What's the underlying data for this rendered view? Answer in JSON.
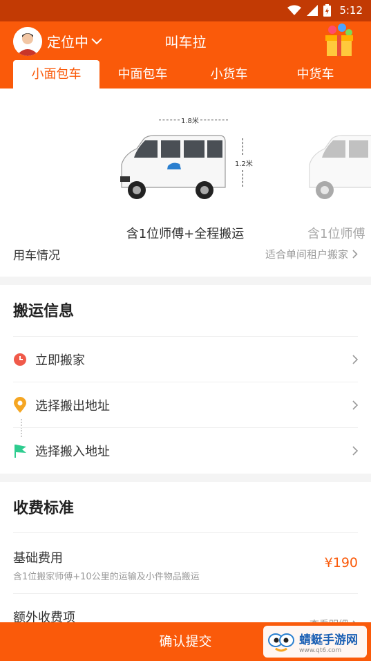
{
  "status_bar": {
    "time": "5:12"
  },
  "header": {
    "location_label": "定位中",
    "title": "叫车拉"
  },
  "tabs": [
    {
      "label": "小面包车",
      "active": true
    },
    {
      "label": "中面包车",
      "active": false
    },
    {
      "label": "小货车",
      "active": false
    },
    {
      "label": "中货车",
      "active": false
    }
  ],
  "vehicles": [
    {
      "width_dim": "1.8米",
      "height_dim": "1.2米",
      "caption": "含1位师傅+全程搬运"
    },
    {
      "caption": "含1位师傅"
    }
  ],
  "usage": {
    "label": "用车情况",
    "value": "适合单间租户搬家"
  },
  "move_info": {
    "title": "搬运信息",
    "items": [
      {
        "label": "立即搬家",
        "icon": "clock-icon",
        "color": "#f05a4a"
      },
      {
        "label": "选择搬出地址",
        "icon": "location-pin-icon",
        "color": "#f5a623"
      },
      {
        "label": "选择搬入地址",
        "icon": "flag-icon",
        "color": "#2ecc8f"
      }
    ]
  },
  "fees": {
    "title": "收费标准",
    "base_title": "基础费用",
    "base_desc": "含1位搬家师傅+10公里的运输及小件物品搬运",
    "base_price": "¥190",
    "extra_title": "额外收费项",
    "extra_link": "查看明细"
  },
  "confirm_button": "确认提交",
  "watermark": {
    "name": "蜻蜓手游网",
    "url": "www.qt6.com"
  },
  "colors": {
    "brand": "#fa5a0a",
    "status_bar": "#c23a04",
    "price": "#fa5a0a"
  }
}
